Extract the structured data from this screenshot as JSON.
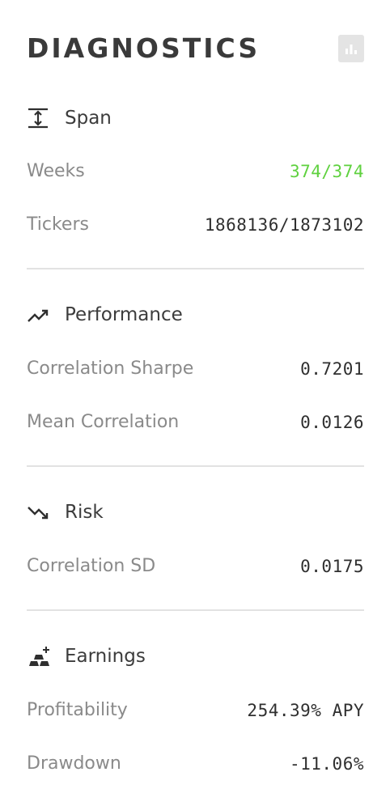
{
  "header": {
    "title": "DIAGNOSTICS",
    "chart_button_icon": "bar-chart-icon"
  },
  "sections": {
    "span": {
      "title": "Span",
      "icon": "vertical-span-icon",
      "rows": [
        {
          "label": "Weeks",
          "value": "374/374",
          "status": "good"
        },
        {
          "label": "Tickers",
          "value": "1868136/1873102"
        }
      ]
    },
    "performance": {
      "title": "Performance",
      "icon": "trending-up-icon",
      "rows": [
        {
          "label": "Correlation Sharpe",
          "value": "0.7201"
        },
        {
          "label": "Mean Correlation",
          "value": "0.0126"
        }
      ]
    },
    "risk": {
      "title": "Risk",
      "icon": "trending-down-icon",
      "rows": [
        {
          "label": "Correlation SD",
          "value": "0.0175"
        }
      ]
    },
    "earnings": {
      "title": "Earnings",
      "icon": "gold-bars-icon",
      "rows": [
        {
          "label": "Profitability",
          "value": "254.39% APY"
        },
        {
          "label": "Drawdown",
          "value": "-11.06%"
        }
      ]
    }
  },
  "colors": {
    "good": "#5fd13f",
    "label": "#8a8a8a",
    "value": "#2f2f2f",
    "divider": "#e2e2e2"
  }
}
